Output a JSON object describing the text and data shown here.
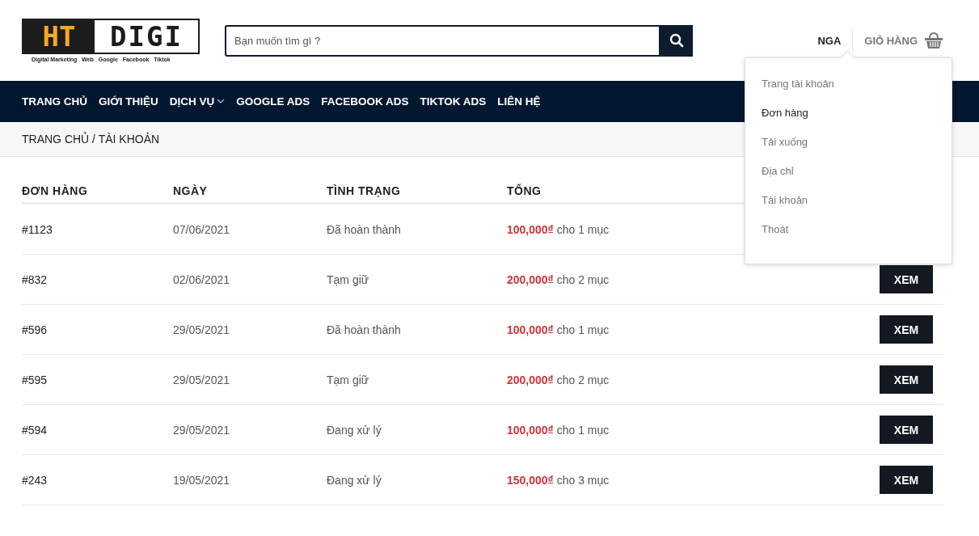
{
  "logo": {
    "part_1": "HT",
    "part_2": "DIGI",
    "tagline": "Digital Marketing   Web   Google   Facebook   Tiktok"
  },
  "search": {
    "placeholder": "Bạn muốn tìm gì ?"
  },
  "account": {
    "label": "NGA"
  },
  "cart": {
    "label": "GIỎ HÀNG"
  },
  "nav": [
    {
      "label": "TRANG CHỦ",
      "has_submenu": false
    },
    {
      "label": "GIỚI THIỆU",
      "has_submenu": false
    },
    {
      "label": "DỊCH VỤ",
      "has_submenu": true
    },
    {
      "label": "GOOGLE ADS",
      "has_submenu": false
    },
    {
      "label": "FACEBOOK ADS",
      "has_submenu": false
    },
    {
      "label": "TIKTOK ADS",
      "has_submenu": false
    },
    {
      "label": "LIÊN HỆ",
      "has_submenu": false
    }
  ],
  "breadcrumb": "TRANG CHỦ / TÀI KHOẢN",
  "account_menu": [
    {
      "label": "Trang tài khoản",
      "selected": false
    },
    {
      "label": "Đơn hàng",
      "selected": true
    },
    {
      "label": "Tải xuống",
      "selected": false
    },
    {
      "label": "Địa chỉ",
      "selected": false
    },
    {
      "label": "Tài khoản",
      "selected": false
    },
    {
      "label": "Thoát",
      "selected": false
    }
  ],
  "table": {
    "columns": [
      "ĐƠN HÀNG",
      "NGÀY",
      "TÌNH TRẠNG",
      "TỔNG"
    ],
    "rows": [
      {
        "order": "#1123",
        "date": "07/06/2021",
        "status": "Đã hoàn thành",
        "amount": "100,000₫",
        "items": "cho 1 mục"
      },
      {
        "order": "#832",
        "date": "02/06/2021",
        "status": "Tạm giữ",
        "amount": "200,000₫",
        "items": "cho 2 mục",
        "action": "XEM"
      },
      {
        "order": "#596",
        "date": "29/05/2021",
        "status": "Đã hoàn thành",
        "amount": "100,000₫",
        "items": "cho 1 mục",
        "action": "XEM"
      },
      {
        "order": "#595",
        "date": "29/05/2021",
        "status": "Tạm giữ",
        "amount": "200,000₫",
        "items": "cho 2 mục",
        "action": "XEM"
      },
      {
        "order": "#594",
        "date": "29/05/2021",
        "status": "Đang xử lý",
        "amount": "100,000₫",
        "items": "cho 1 mục",
        "action": "XEM"
      },
      {
        "order": "#243",
        "date": "19/05/2021",
        "status": "Đang xử lý",
        "amount": "150,000₫",
        "items": "cho 3 mục",
        "action": "XEM"
      }
    ]
  }
}
